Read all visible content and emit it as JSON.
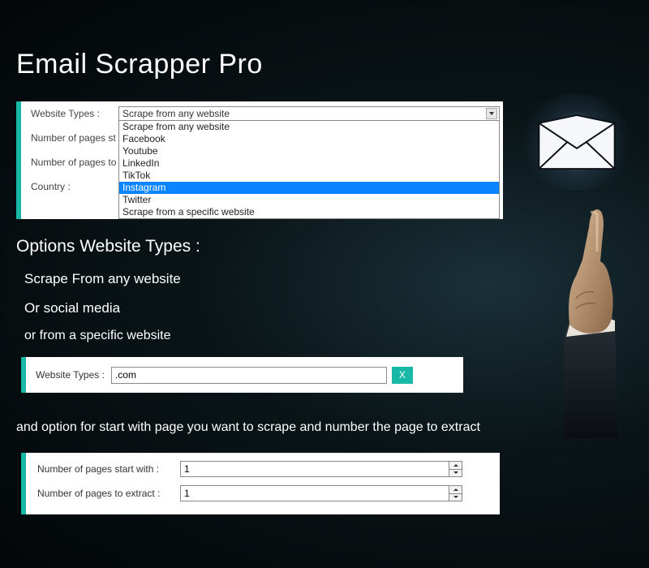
{
  "title": "Email Scrapper Pro",
  "panel1": {
    "labels": {
      "website_types": "Website Types :",
      "pages_start": "Number of pages st",
      "pages_extract": "Number of pages to",
      "country": "Country :"
    },
    "combo_selected": "Scrape from any website",
    "combo_items": [
      "Scrape from any website",
      "Facebook",
      "Youtube",
      "LinkedIn",
      "TikTok",
      "Instagram",
      "Twitter",
      "Scrape from a specific website"
    ],
    "combo_highlight_index": 5
  },
  "section_heading": "Options Website Types :",
  "options": {
    "line1": "Scrape From any website",
    "line2": "Or social media",
    "line3": "or from a specific website"
  },
  "panel2": {
    "label": "Website Types :",
    "value": ".com",
    "xbtn": "X"
  },
  "and_option": "and option for start with page you want to scrape and number the page to extract",
  "panel3": {
    "row1_label": "Number of pages start with :",
    "row1_value": "1",
    "row2_label": "Number of pages to extract :",
    "row2_value": "1"
  }
}
